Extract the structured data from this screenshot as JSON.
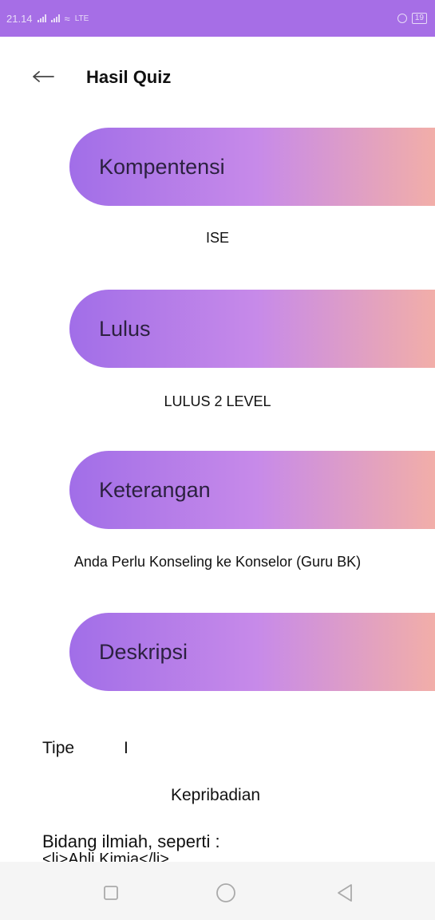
{
  "status_bar": {
    "time": "21.14",
    "network": "LTE",
    "battery": "19"
  },
  "header": {
    "title": "Hasil Quiz"
  },
  "sections": [
    {
      "label": "Kompentensi",
      "value": "ISE"
    },
    {
      "label": "Lulus",
      "value": "LULUS 2 LEVEL"
    },
    {
      "label": "Keterangan",
      "value": "Anda Perlu Konseling ke Konselor (Guru BK)"
    },
    {
      "label": "Deskripsi"
    }
  ],
  "description": {
    "type_label": "Tipe",
    "type_value": "I",
    "personality": "Kepribadian",
    "field_line": "Bidang  ilmiah, seperti :",
    "list_item": "<li>Ahli Kimia</li>"
  },
  "colors": {
    "status_bar": "#a66ee6",
    "gradient_start": "#a16ee8",
    "gradient_mid": "#c78ae9",
    "gradient_end": "#f4b0a5"
  },
  "icons": {
    "back": "arrow-left-icon",
    "nav_recent": "square-icon",
    "nav_home": "circle-icon",
    "nav_back": "triangle-icon"
  }
}
